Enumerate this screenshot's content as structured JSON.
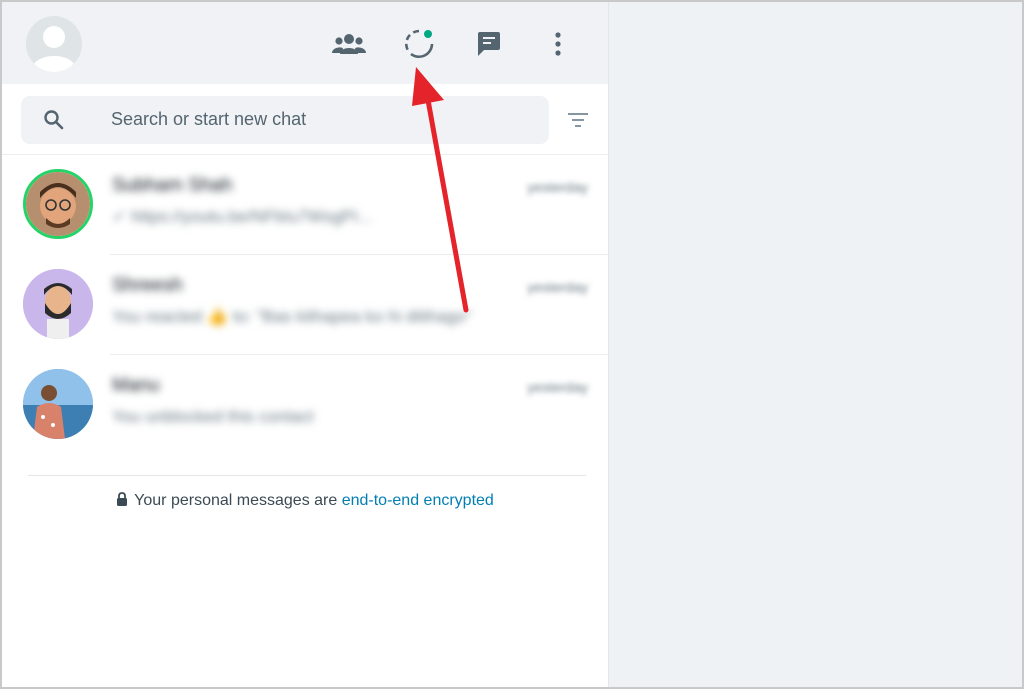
{
  "colors": {
    "header_bg": "#f0f2f5",
    "right_panel_bg": "#eff2f5",
    "icon_gray": "#54656f",
    "status_dot": "#00a884",
    "link": "#027eb5",
    "annotation_arrow": "#e4232b",
    "story_ring": "#25d366"
  },
  "header": {
    "profile_icon": "default-profile-avatar-icon",
    "icons": [
      "communities-icon",
      "status-icon",
      "new-chat-icon",
      "menu-icon"
    ]
  },
  "search": {
    "placeholder": "Search or start new chat",
    "icon": "search-icon",
    "filter_icon": "filter-icon"
  },
  "chats": [
    {
      "name": "Subham Shah",
      "preview": "✓ https://youtu.be/NFbIu7WsgPI...",
      "time": "yesterday"
    },
    {
      "name": "Shreesh",
      "preview": "You reacted 👍 to: \"Bas kithapea ko hi ditihago\"",
      "time": "yesterday"
    },
    {
      "name": "Manu",
      "preview": "You unblocked this contact",
      "time": "yesterday"
    }
  ],
  "footer": {
    "encryption_text": "Your personal messages are ",
    "encryption_link": "end-to-end encrypted"
  }
}
